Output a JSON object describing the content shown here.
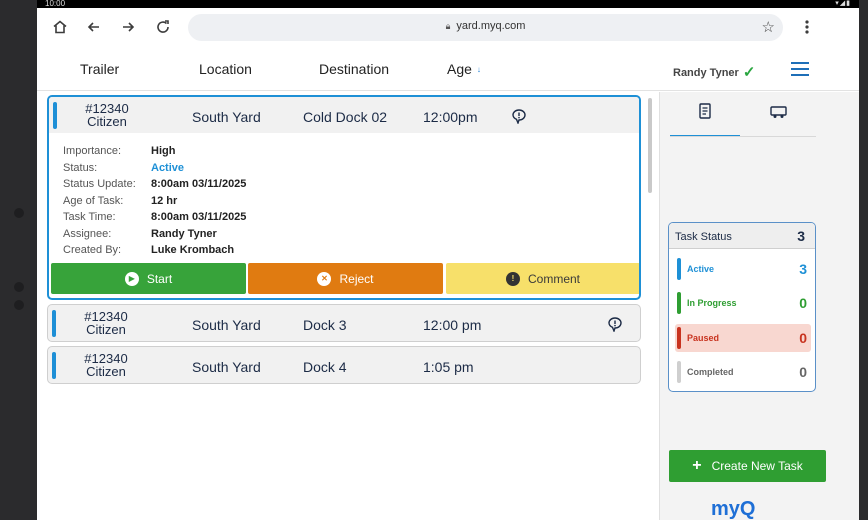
{
  "system": {
    "time": "10:00",
    "status_icons": "▾◢▮"
  },
  "browser": {
    "url": "yard.myq.com"
  },
  "header": {
    "columns": [
      "Trailer",
      "Location",
      "Destination",
      "Age"
    ],
    "user_name": "Randy Tyner"
  },
  "tasks": [
    {
      "trailer_num": "#12340",
      "carrier": "Citizen",
      "location": "South Yard",
      "destination": "Cold Dock 02",
      "time": "12:00pm",
      "has_comment": true,
      "expanded": true,
      "details": [
        {
          "label": "Importance:",
          "value": "High"
        },
        {
          "label": "Status:",
          "value": "Active"
        },
        {
          "label": "Status Update:",
          "value": "8:00am 03/11/2025"
        },
        {
          "label": "Age of Task:",
          "value": "12 hr"
        },
        {
          "label": "Task Time:",
          "value": "8:00am 03/11/2025"
        },
        {
          "label": "Assignee:",
          "value": "Randy Tyner"
        },
        {
          "label": "Created By:",
          "value": "Luke Krombach"
        }
      ],
      "actions": {
        "start": "Start",
        "reject": "Reject",
        "comment": "Comment"
      }
    },
    {
      "trailer_num": "#12340",
      "carrier": "Citizen",
      "location": "South Yard",
      "destination": "Dock 3",
      "time": "12:00 pm",
      "has_comment": true,
      "expanded": false
    },
    {
      "trailer_num": "#12340",
      "carrier": "Citizen",
      "location": "South Yard",
      "destination": "Dock 4",
      "time": "1:05 pm",
      "has_comment": false,
      "expanded": false
    }
  ],
  "side": {
    "tabs": [
      {
        "icon": "document-icon",
        "active": true
      },
      {
        "icon": "truck-icon",
        "active": false
      }
    ],
    "task_status": {
      "title": "Task Status",
      "total": "3",
      "rows": [
        {
          "label": "Active",
          "count": "3",
          "color": "#1e90d6",
          "bg": "#ffffff",
          "text": "#1e90d6"
        },
        {
          "label": "In Progress",
          "count": "0",
          "color": "#2f9e32",
          "bg": "#ffffff",
          "text": "#2f9e32"
        },
        {
          "label": "Paused",
          "count": "0",
          "color": "#c8331f",
          "bg": "#f8d7d0",
          "text": "#c8331f"
        },
        {
          "label": "Completed",
          "count": "0",
          "color": "#cfcfcf",
          "bg": "#ffffff",
          "text": "#666666"
        }
      ]
    },
    "create_button": "Create New Task",
    "logo": "myQ"
  }
}
